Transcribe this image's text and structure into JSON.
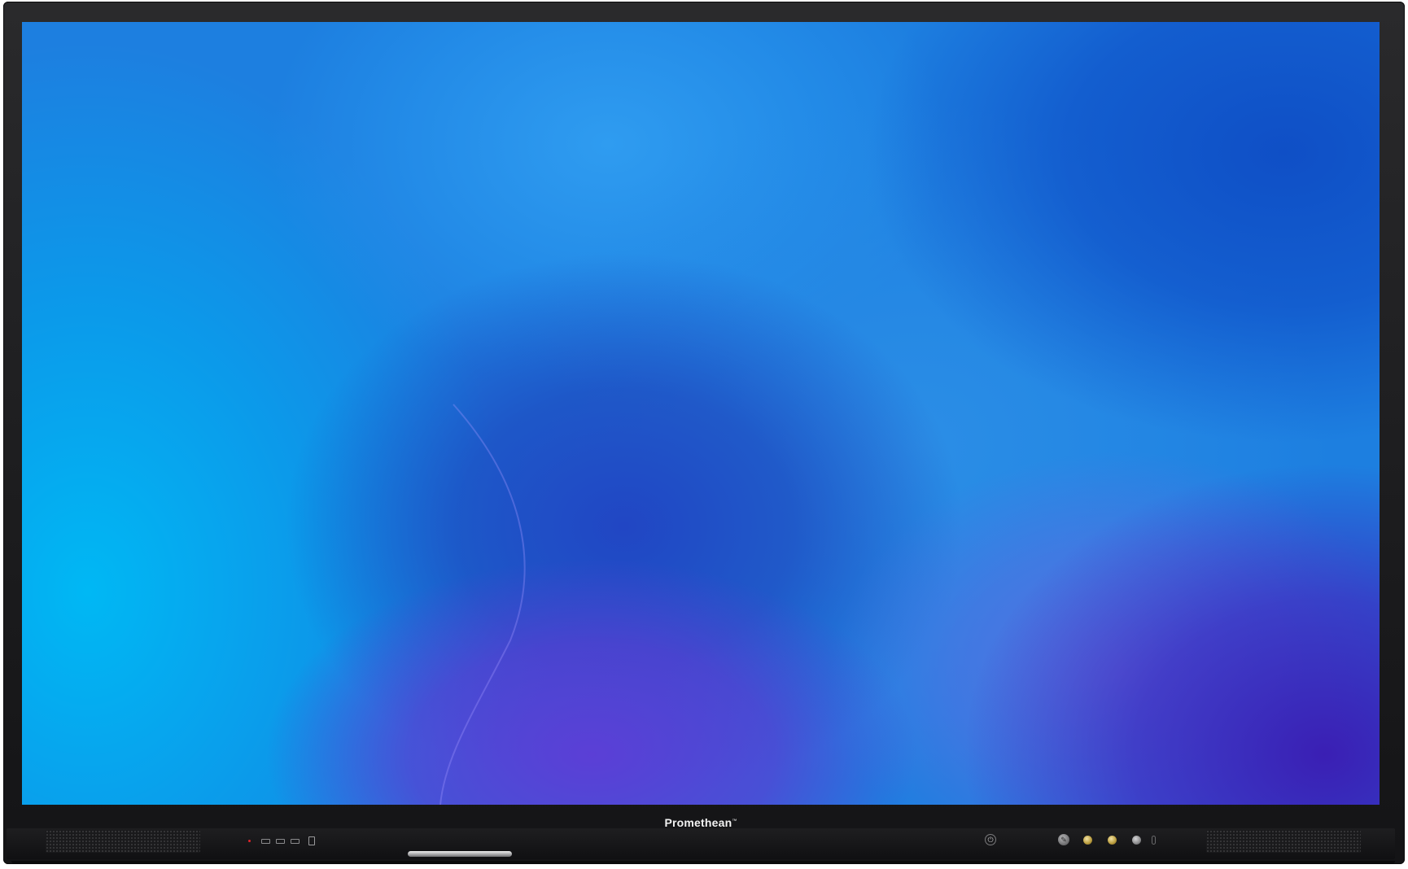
{
  "device": {
    "brand": "Promethean",
    "brand_mark": "™"
  },
  "icons": {
    "power": "power-icon",
    "pen": "pen-icon",
    "led": "status-led-icon",
    "usb": "usb-port-icon",
    "hdmi": "hdmi-port-icon"
  },
  "colors": {
    "bezel": "#1c1c1e",
    "screen_cyan": "#00b8f4",
    "screen_blue": "#1d7fe0",
    "screen_indigo": "#3a1fb4",
    "status_led": "#e0242a",
    "button_gold": "#b89a3a"
  }
}
